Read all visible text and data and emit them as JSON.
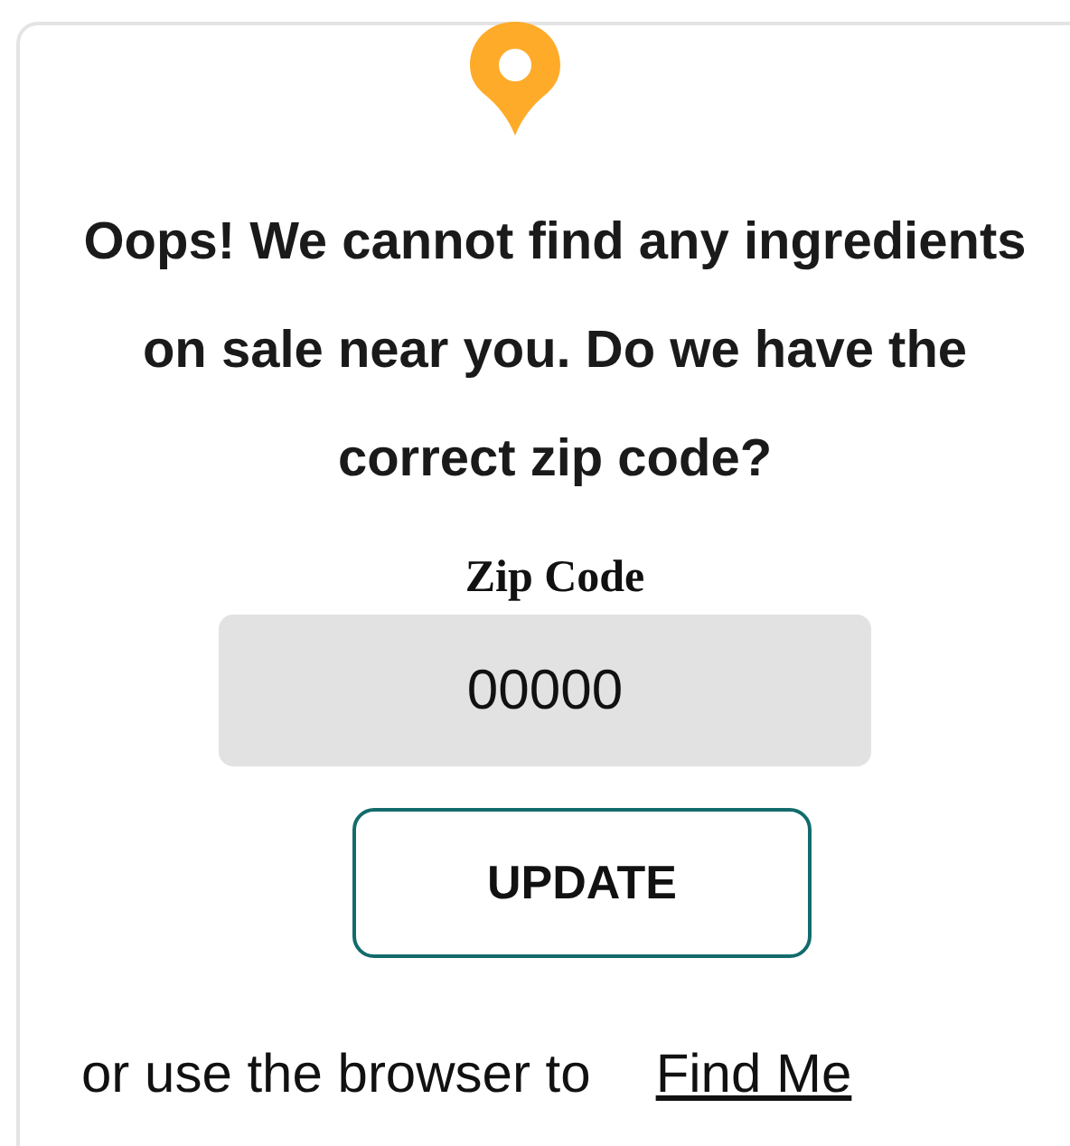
{
  "message": "Oops! We cannot find any ingredients on sale near you. Do we have the correct zip code?",
  "zip_field": {
    "label": "Zip Code",
    "value": "00000"
  },
  "update_button": {
    "label": "UPDATE"
  },
  "footer": {
    "text": "or use the browser to",
    "link": "Find Me"
  }
}
